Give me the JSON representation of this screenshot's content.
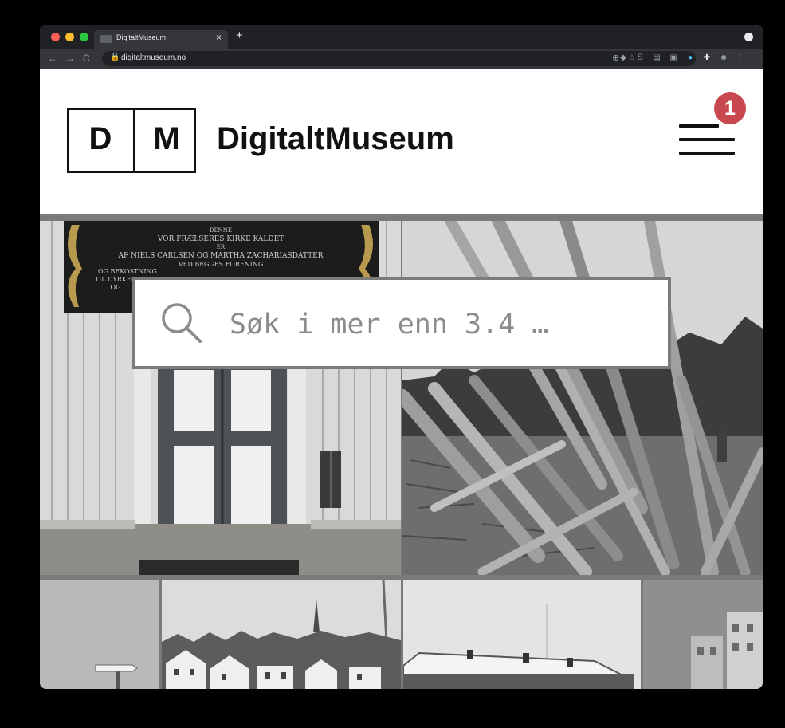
{
  "browser": {
    "tab_title": "DigitaltMuseum",
    "tab_close": "×",
    "new_tab": "+",
    "url": "digitaltmuseum.no",
    "traffic_light_colors": [
      "#ff5f57",
      "#febc2e",
      "#28c840"
    ],
    "extension_icons": [
      "S",
      "O"
    ]
  },
  "site": {
    "logo_left": "D",
    "logo_right": "M",
    "brand_name": "DigitaltMuseum",
    "menu_badge": "1",
    "badge_color": "#c9474f"
  },
  "search": {
    "placeholder": "Søk i mer enn 3.4 …"
  },
  "plaque": {
    "line1": "DENNE",
    "line2": "VOR FRÆLSERES KIRKE KALDET",
    "line3": "ER",
    "line4": "AF NIELS CARLSEN OG MARTHA ZACHARIASDATTER",
    "line5": "VED BEGGES FORENING",
    "line6": "OG BEKOSTNING",
    "line7": "TIL DYRKELSE",
    "line8": "OG"
  }
}
